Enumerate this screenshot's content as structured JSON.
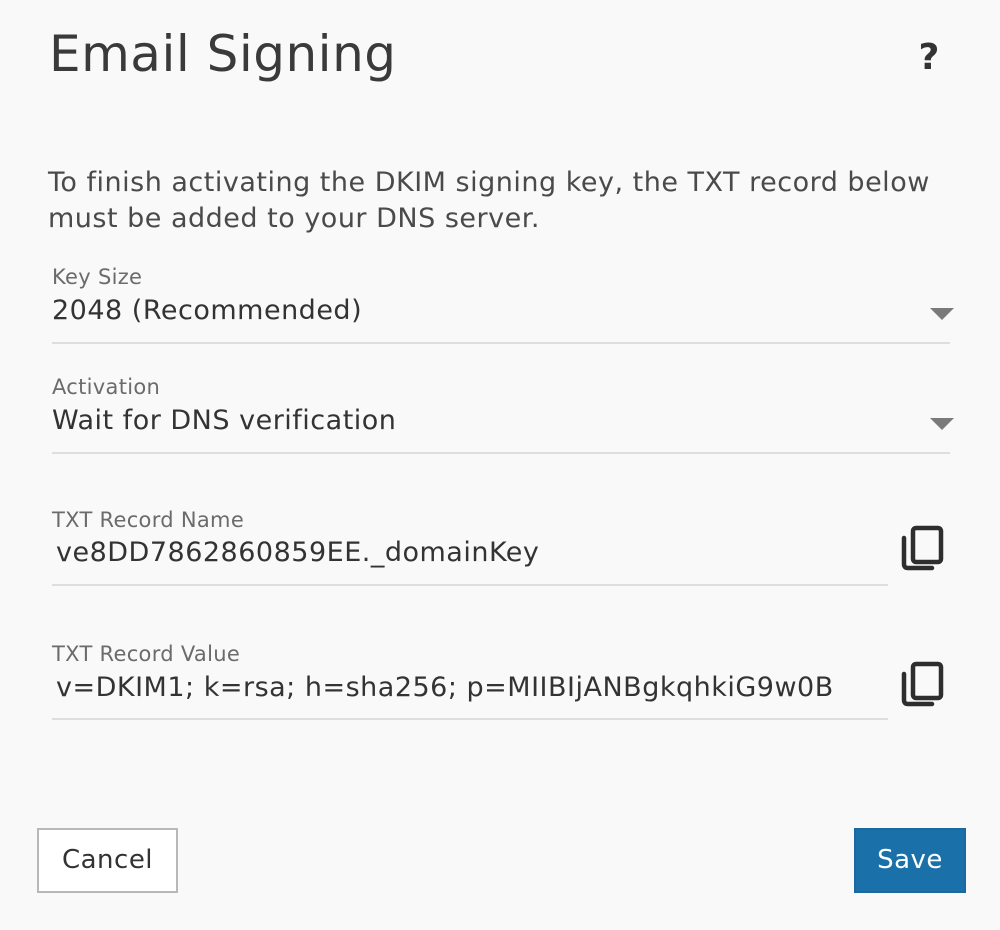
{
  "dialog": {
    "title": "Email Signing",
    "help_label": "?",
    "description": "To finish activating the DKIM signing key, the TXT record below must be added to your DNS server."
  },
  "fields": {
    "key_size": {
      "label": "Key Size",
      "value": "2048 (Recommended)",
      "icon": "chevron-down-icon"
    },
    "activation": {
      "label": "Activation",
      "value": "Wait for DNS verification",
      "icon": "chevron-down-icon"
    },
    "txt_record_name": {
      "label": "TXT Record Name",
      "value": "ve8DD7862860859EE._domainKey",
      "icon": "copy-icon"
    },
    "txt_record_value": {
      "label": "TXT Record Value",
      "value": "v=DKIM1; k=rsa; h=sha256; p=MIIBIjANBgkqhkiG9w0B",
      "icon": "copy-icon"
    }
  },
  "buttons": {
    "cancel_label": "Cancel",
    "save_label": "Save"
  },
  "colors": {
    "background": "#f9f9f9",
    "primary_button": "#1a70a8",
    "divider": "#dedede"
  }
}
